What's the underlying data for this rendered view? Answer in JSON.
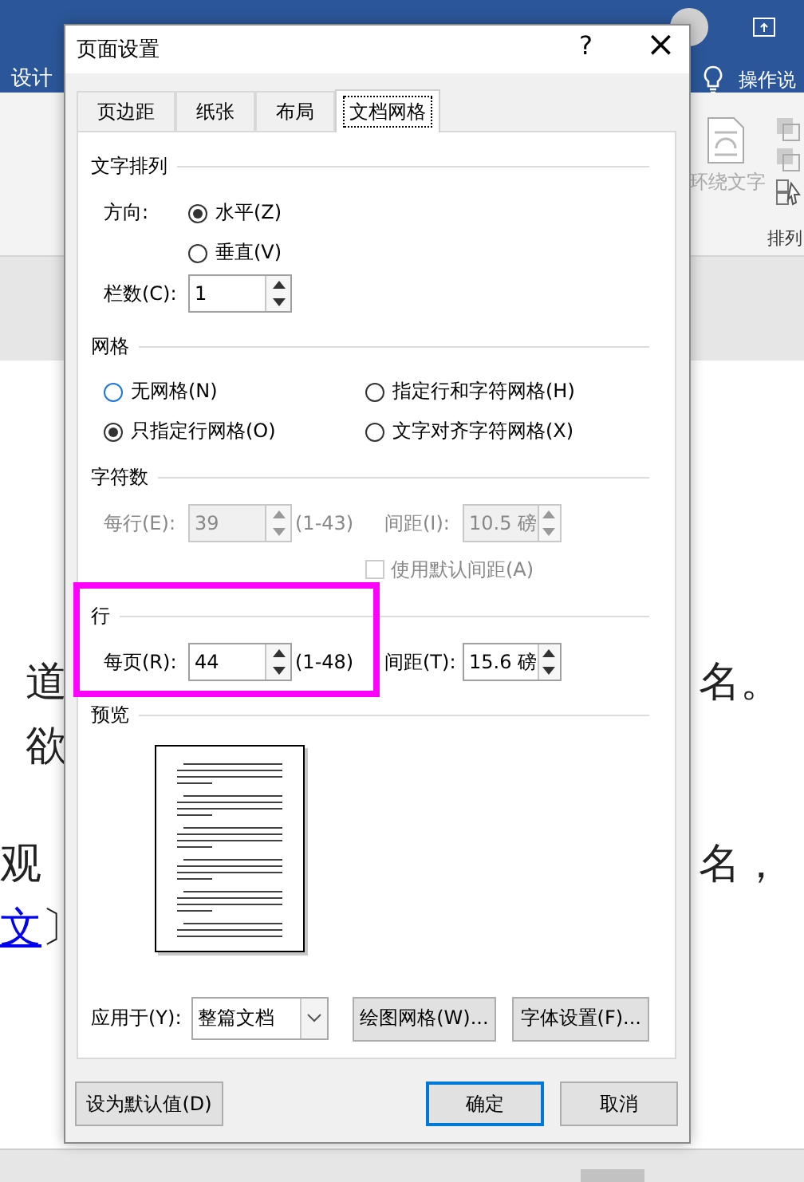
{
  "app": {
    "ribbon_tab": "设计",
    "tell_me": "操作说",
    "wrap_text": "环绕文字",
    "arrange": "排列"
  },
  "document": {
    "lines": [
      {
        "left": "道",
        "right": "名。",
        "link": false
      },
      {
        "left": "欲",
        "link": false
      },
      {
        "left": "观",
        "right": "名，",
        "link": false
      },
      {
        "left": "文",
        "tail": "〕",
        "link": true
      }
    ]
  },
  "dialog": {
    "title": "页面设置",
    "help": "?",
    "close": "×",
    "tabs": [
      {
        "label": "页边距",
        "selected": false
      },
      {
        "label": "纸张",
        "selected": false
      },
      {
        "label": "布局",
        "selected": false
      },
      {
        "label": "文档网格",
        "selected": true
      }
    ],
    "text_direction": {
      "title": "文字排列",
      "label": "方向:",
      "options": [
        {
          "label": "水平(Z)",
          "selected": true
        },
        {
          "label": "垂直(V)",
          "selected": false
        }
      ],
      "columns": {
        "label": "栏数(C):",
        "value": "1",
        "disabled": false
      }
    },
    "grid": {
      "title": "网格",
      "options": [
        {
          "label": "无网格(N)",
          "selected": false
        },
        {
          "label": "指定行和字符网格(H)",
          "selected": false
        },
        {
          "label": "只指定行网格(O)",
          "selected": true
        },
        {
          "label": "文字对齐字符网格(X)",
          "selected": false
        }
      ]
    },
    "characters": {
      "title": "字符数",
      "count": {
        "label": "每行(E):",
        "value": "39",
        "range": "(1-43)",
        "disabled": true
      },
      "pitch": {
        "label": "间距(I):",
        "value": "10.5 磅",
        "disabled": true
      },
      "default_pitch": {
        "label": "使用默认间距(A)",
        "checked": false,
        "disabled": true
      }
    },
    "lines": {
      "title": "行",
      "count": {
        "label": "每页(R):",
        "value": "44",
        "range": "(1-48)",
        "disabled": false
      },
      "pitch": {
        "label": "间距(T):",
        "value": "15.6 磅",
        "disabled": false
      },
      "highlighted": true
    },
    "preview": {
      "title": "预览"
    },
    "apply_to": {
      "label": "应用于(Y):",
      "value": "整篇文档"
    },
    "buttons": [
      {
        "label": "绘图网格(W)..."
      },
      {
        "label": "字体设置(F)..."
      }
    ],
    "footer": {
      "default_button": "设为默认值(D)",
      "ok": "确定",
      "cancel": "取消"
    }
  }
}
